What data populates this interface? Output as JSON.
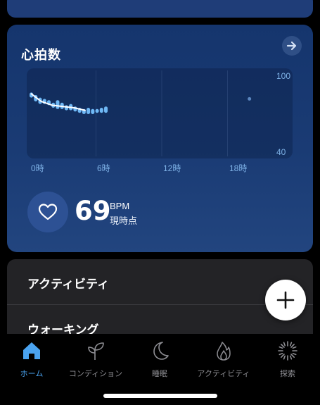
{
  "heart_rate_card": {
    "title": "心拍数",
    "y_axis": {
      "max_label": "100",
      "min_label": "40"
    },
    "x_axis_labels": [
      "0時",
      "6時",
      "12時",
      "18時"
    ],
    "current_bpm": "69",
    "unit": "BPM",
    "note": "現時点"
  },
  "chart_data": {
    "type": "line",
    "x_unit_note": "hours",
    "ylim": [
      40,
      100
    ],
    "xlim": [
      0,
      24
    ],
    "x_ticks": [
      "0時",
      "6時",
      "12時",
      "18時"
    ],
    "range_bars": [
      {
        "x": 0.1,
        "low": 83,
        "high": 87
      },
      {
        "x": 0.5,
        "low": 80,
        "high": 85
      },
      {
        "x": 0.9,
        "low": 78,
        "high": 83
      },
      {
        "x": 1.3,
        "low": 78,
        "high": 82
      },
      {
        "x": 1.7,
        "low": 77,
        "high": 81
      },
      {
        "x": 2.1,
        "low": 75,
        "high": 79
      },
      {
        "x": 2.5,
        "low": 74,
        "high": 81
      },
      {
        "x": 2.9,
        "low": 74,
        "high": 79
      },
      {
        "x": 3.3,
        "low": 73,
        "high": 77
      },
      {
        "x": 3.7,
        "low": 73,
        "high": 78
      },
      {
        "x": 4.1,
        "low": 72,
        "high": 76
      },
      {
        "x": 4.5,
        "low": 71,
        "high": 75
      },
      {
        "x": 4.9,
        "low": 70,
        "high": 74
      },
      {
        "x": 5.3,
        "low": 70,
        "high": 75
      },
      {
        "x": 5.7,
        "low": 70,
        "high": 74
      },
      {
        "x": 6.1,
        "low": 71,
        "high": 74
      },
      {
        "x": 6.5,
        "low": 71,
        "high": 75
      },
      {
        "x": 6.9,
        "low": 71,
        "high": 76
      }
    ],
    "trend_line": [
      {
        "x": 0.1,
        "y": 86
      },
      {
        "x": 1.0,
        "y": 80
      },
      {
        "x": 2.0,
        "y": 77
      },
      {
        "x": 3.0,
        "y": 76
      },
      {
        "x": 4.0,
        "y": 75
      },
      {
        "x": 5.0,
        "y": 73
      }
    ],
    "isolated_point": {
      "x": 20.0,
      "y": 82
    }
  },
  "activity_list": {
    "items": [
      "アクティビティ",
      "ウォーキング"
    ]
  },
  "tabbar": {
    "tabs": [
      {
        "label": "ホーム",
        "icon": "home-icon",
        "active": true
      },
      {
        "label": "コンディション",
        "icon": "sprout-icon",
        "active": false
      },
      {
        "label": "睡眠",
        "icon": "moon-icon",
        "active": false
      },
      {
        "label": "アクティビティ",
        "icon": "flame-icon",
        "active": false
      },
      {
        "label": "探索",
        "icon": "sparkle-icon",
        "active": false
      }
    ]
  },
  "colors": {
    "accent": "#4aa3f0",
    "chart_bar": "#6fb8f5",
    "card_bg": "#1a3b74"
  }
}
